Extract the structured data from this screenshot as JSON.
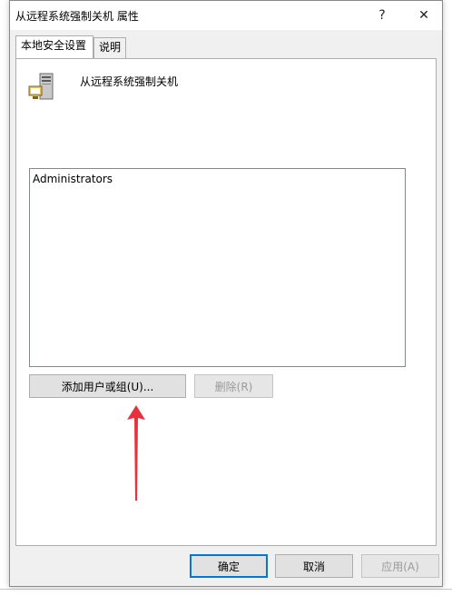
{
  "window": {
    "title": "从远程系统强制关机 属性",
    "help_label": "?",
    "close_label": "✕"
  },
  "tabs": [
    {
      "label": "本地安全设置",
      "active": true
    },
    {
      "label": "说明",
      "active": false
    }
  ],
  "policy": {
    "icon": "server-computer-icon",
    "name": "从远程系统强制关机"
  },
  "members": {
    "items": [
      "Administrators"
    ]
  },
  "buttons": {
    "add": "添加用户或组(U)...",
    "remove": "删除(R)",
    "ok": "确定",
    "cancel": "取消",
    "apply": "应用(A)"
  },
  "colors": {
    "accent": "#0078d7",
    "arrow": "#e8313a"
  }
}
